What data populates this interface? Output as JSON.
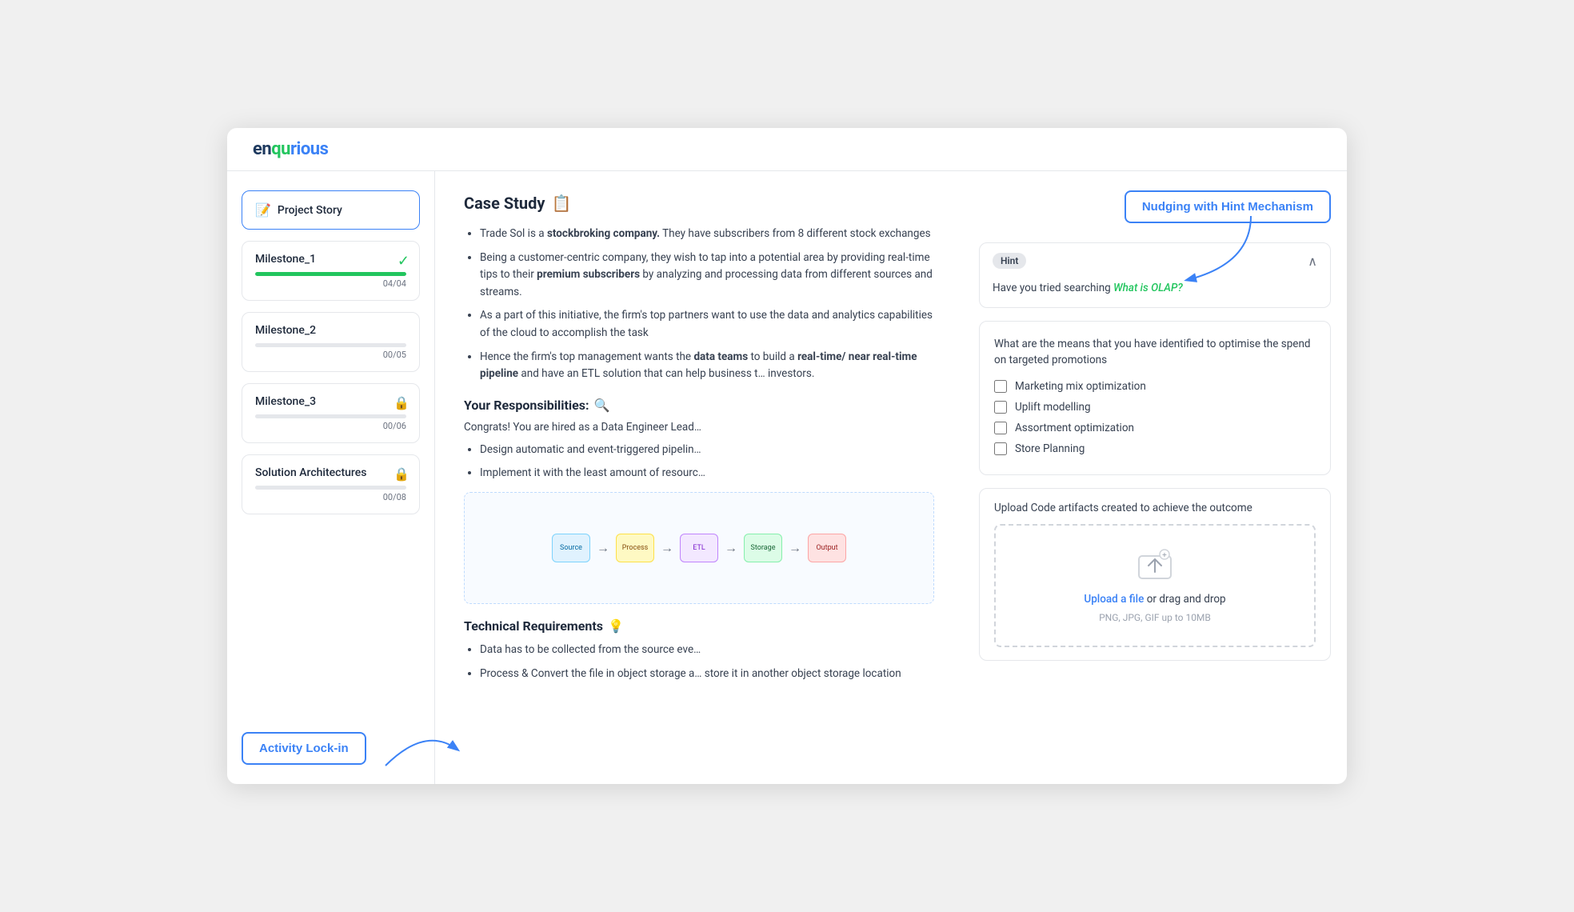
{
  "app": {
    "logo": "ENQURIOUS",
    "logo_parts": [
      "EN",
      "QU",
      "RIOUS"
    ]
  },
  "sidebar": {
    "items": [
      {
        "id": "project-story",
        "label": "Project Story",
        "emoji": "📝",
        "active": true,
        "locked": false,
        "completed": false,
        "progress": null,
        "progress_label": null
      },
      {
        "id": "milestone-1",
        "label": "Milestone_1",
        "emoji": null,
        "active": false,
        "locked": false,
        "completed": true,
        "progress": 100,
        "progress_label": "04/04",
        "color": "#22c55e"
      },
      {
        "id": "milestone-2",
        "label": "Milestone_2",
        "emoji": null,
        "active": false,
        "locked": false,
        "completed": false,
        "progress": 0,
        "progress_label": "00/05",
        "color": "#d1d5db"
      },
      {
        "id": "milestone-3",
        "label": "Milestone_3",
        "emoji": null,
        "active": false,
        "locked": true,
        "completed": false,
        "progress": 0,
        "progress_label": "00/06",
        "color": "#d1d5db"
      },
      {
        "id": "solution-architectures",
        "label": "Solution Architectures",
        "emoji": null,
        "active": false,
        "locked": true,
        "completed": false,
        "progress": 0,
        "progress_label": "00/08",
        "color": "#d1d5db"
      }
    ],
    "activity_lock_btn": "Activity Lock-in"
  },
  "case_study": {
    "title": "Case Study",
    "title_emoji": "📋",
    "bullets": [
      "Trade Sol is a <b>stockbroking company.</b> They have subscribers from 8 different stock exchanges",
      "Being a customer-centric company, they wish to tap into a potential area by providing real-time tips to their <b>premium subscribers</b> by analyzing and processing data from different sources and streams.",
      "As a part of this initiative, the firm's top partners want to use the data and analytics capabilities of the cloud to accomplish the task",
      "Hence the firm's top management wants the <b>data teams</b> to build a <b>real-time/ near real-time pipeline</b> and have an ETL solution that can help business t… investors."
    ]
  },
  "responsibilities": {
    "title": "Your Responsibilities:",
    "title_emoji": "🔍",
    "intro": "Congrats! You are hired as a Data Engineer Lead…",
    "bullets": [
      "Design automatic and event-triggered pipelin…",
      "Implement it with the least amount of resourc…"
    ]
  },
  "technical_requirements": {
    "title": "Technical Requirements",
    "title_emoji": "💡",
    "bullets": [
      "Data has to be collected from the source eve…",
      "Process & Convert the file in object storage a… store it in another object storage location"
    ]
  },
  "nudge": {
    "label": "Nudging with Hint Mechanism"
  },
  "hint": {
    "badge": "Hint",
    "question_prefix": "Have you tried searching ",
    "link_text": "What is OLAP?",
    "chevron": "∧"
  },
  "question": {
    "text": "What are the means that you have identified to optimise the spend on targeted promotions",
    "options": [
      {
        "id": "opt1",
        "label": "Marketing mix optimization",
        "checked": false
      },
      {
        "id": "opt2",
        "label": "Uplift modelling",
        "checked": false
      },
      {
        "id": "opt3",
        "label": "Assortment optimization",
        "checked": false
      },
      {
        "id": "opt4",
        "label": "Store Planning",
        "checked": false
      }
    ]
  },
  "upload": {
    "title": "Upload Code artifacts created to achieve the outcome",
    "link_text": "Upload a file",
    "or_text": " or drag and drop",
    "subtext": "PNG, JPG, GIF up to 10MB"
  }
}
